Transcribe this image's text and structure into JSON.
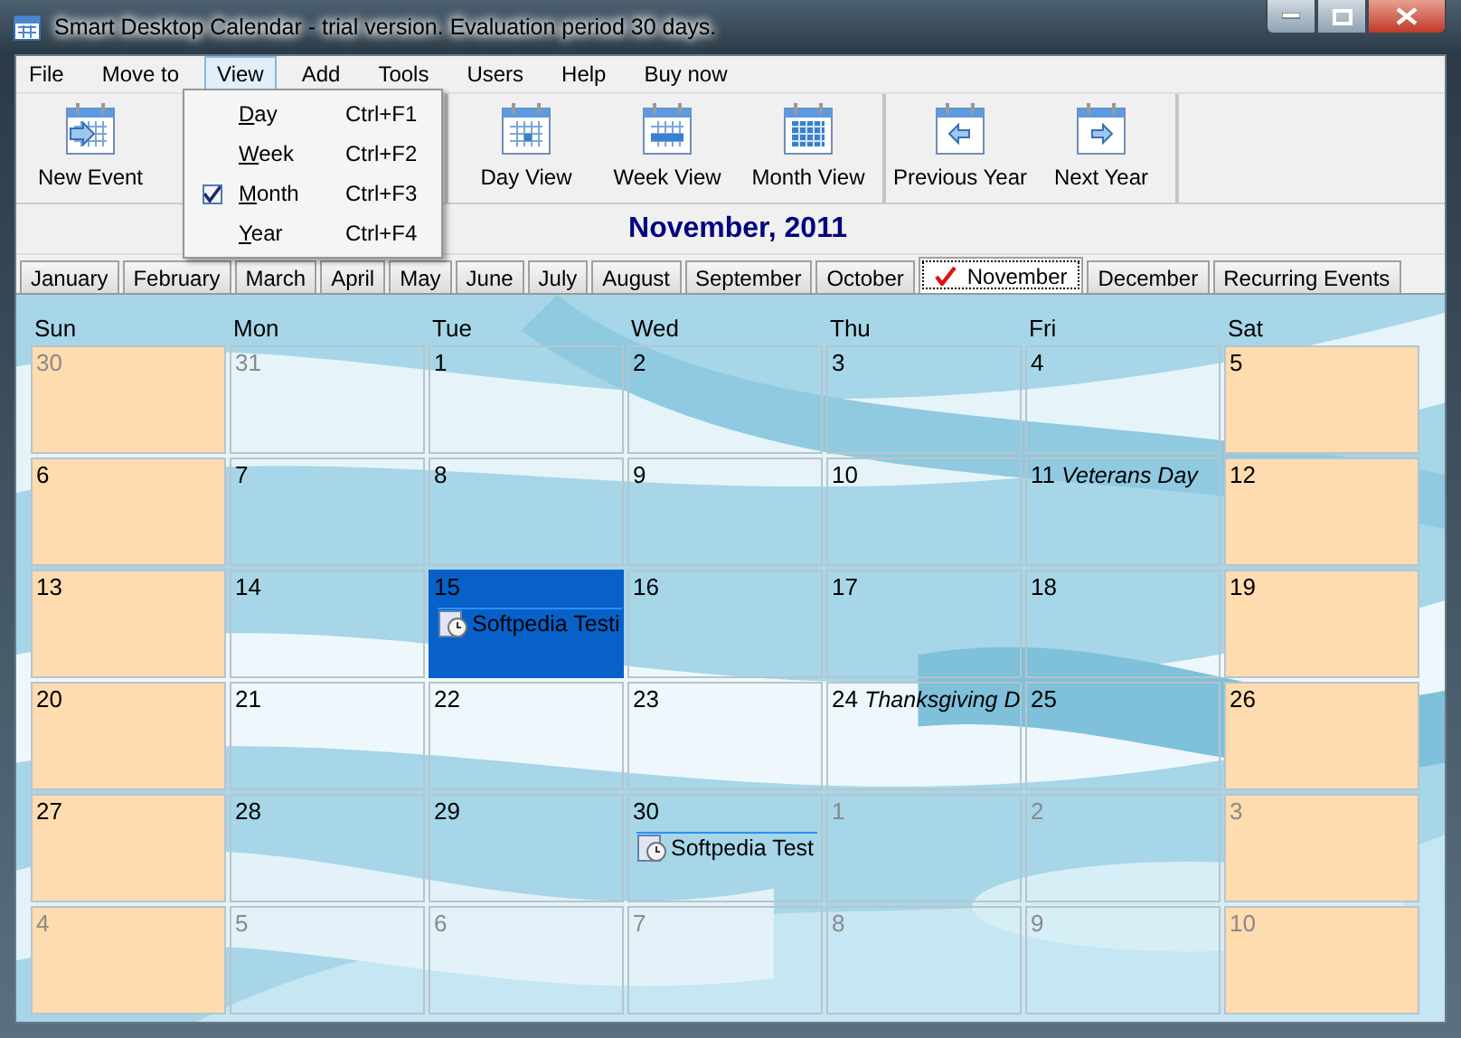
{
  "window": {
    "title": "Smart Desktop Calendar - trial version. Evaluation period 30 days."
  },
  "menu_bar": [
    {
      "label": "File",
      "open": false
    },
    {
      "label": "Move to",
      "open": false
    },
    {
      "label": "View",
      "open": true
    },
    {
      "label": "Add",
      "open": false
    },
    {
      "label": "Tools",
      "open": false
    },
    {
      "label": "Users",
      "open": false
    },
    {
      "label": "Help",
      "open": false
    },
    {
      "label": "Buy now",
      "open": false
    }
  ],
  "view_menu": [
    {
      "label": "Day",
      "shortcut": "Ctrl+F1",
      "checked": false
    },
    {
      "label": "Week",
      "shortcut": "Ctrl+F2",
      "checked": false
    },
    {
      "label": "Month",
      "shortcut": "Ctrl+F3",
      "checked": true
    },
    {
      "label": "Year",
      "shortcut": "Ctrl+F4",
      "checked": false
    }
  ],
  "toolbar": [
    {
      "label": "New Event",
      "kind": "new"
    },
    {
      "label": "Day View",
      "kind": "day"
    },
    {
      "label": "Week View",
      "kind": "week"
    },
    {
      "label": "Month View",
      "kind": "month"
    },
    {
      "label": "Previous Year",
      "kind": "prev"
    },
    {
      "label": "Next Year",
      "kind": "next"
    }
  ],
  "heading": "November, 2011",
  "month_tabs": [
    {
      "label": "January",
      "selected": false
    },
    {
      "label": "February",
      "selected": false
    },
    {
      "label": "March",
      "selected": false
    },
    {
      "label": "April",
      "selected": false
    },
    {
      "label": "May",
      "selected": false
    },
    {
      "label": "June",
      "selected": false
    },
    {
      "label": "July",
      "selected": false
    },
    {
      "label": "August",
      "selected": false
    },
    {
      "label": "September",
      "selected": false
    },
    {
      "label": "October",
      "selected": false
    },
    {
      "label": "November",
      "selected": true
    },
    {
      "label": "December",
      "selected": false
    },
    {
      "label": "Recurring Events",
      "selected": false
    }
  ],
  "calendar": {
    "weekdays": [
      "Sun",
      "Mon",
      "Tue",
      "Wed",
      "Thu",
      "Fri",
      "Sat"
    ],
    "weeks": [
      [
        {
          "day": "30",
          "other_month": true,
          "weekend": true,
          "selected": false
        },
        {
          "day": "31",
          "other_month": true,
          "weekend": false,
          "selected": false
        },
        {
          "day": "1",
          "other_month": false,
          "weekend": false,
          "selected": false
        },
        {
          "day": "2",
          "other_month": false,
          "weekend": false,
          "selected": false
        },
        {
          "day": "3",
          "other_month": false,
          "weekend": false,
          "selected": false
        },
        {
          "day": "4",
          "other_month": false,
          "weekend": false,
          "selected": false
        },
        {
          "day": "5",
          "other_month": false,
          "weekend": true,
          "selected": false
        }
      ],
      [
        {
          "day": "6",
          "other_month": false,
          "weekend": true,
          "selected": false
        },
        {
          "day": "7",
          "other_month": false,
          "weekend": false,
          "selected": false
        },
        {
          "day": "8",
          "other_month": false,
          "weekend": false,
          "selected": false
        },
        {
          "day": "9",
          "other_month": false,
          "weekend": false,
          "selected": false
        },
        {
          "day": "10",
          "other_month": false,
          "weekend": false,
          "selected": false
        },
        {
          "day": "11",
          "other_month": false,
          "weekend": false,
          "selected": false,
          "holiday": "Veterans Day"
        },
        {
          "day": "12",
          "other_month": false,
          "weekend": true,
          "selected": false
        }
      ],
      [
        {
          "day": "13",
          "other_month": false,
          "weekend": true,
          "selected": false
        },
        {
          "day": "14",
          "other_month": false,
          "weekend": false,
          "selected": false
        },
        {
          "day": "15",
          "other_month": false,
          "weekend": false,
          "selected": true,
          "events": [
            "Softpedia Testi"
          ]
        },
        {
          "day": "16",
          "other_month": false,
          "weekend": false,
          "selected": false
        },
        {
          "day": "17",
          "other_month": false,
          "weekend": false,
          "selected": false
        },
        {
          "day": "18",
          "other_month": false,
          "weekend": false,
          "selected": false
        },
        {
          "day": "19",
          "other_month": false,
          "weekend": true,
          "selected": false
        }
      ],
      [
        {
          "day": "20",
          "other_month": false,
          "weekend": true,
          "selected": false
        },
        {
          "day": "21",
          "other_month": false,
          "weekend": false,
          "selected": false
        },
        {
          "day": "22",
          "other_month": false,
          "weekend": false,
          "selected": false
        },
        {
          "day": "23",
          "other_month": false,
          "weekend": false,
          "selected": false
        },
        {
          "day": "24",
          "other_month": false,
          "weekend": false,
          "selected": false,
          "holiday": "Thanksgiving D"
        },
        {
          "day": "25",
          "other_month": false,
          "weekend": false,
          "selected": false
        },
        {
          "day": "26",
          "other_month": false,
          "weekend": true,
          "selected": false
        }
      ],
      [
        {
          "day": "27",
          "other_month": false,
          "weekend": true,
          "selected": false
        },
        {
          "day": "28",
          "other_month": false,
          "weekend": false,
          "selected": false
        },
        {
          "day": "29",
          "other_month": false,
          "weekend": false,
          "selected": false
        },
        {
          "day": "30",
          "other_month": false,
          "weekend": false,
          "selected": false,
          "events": [
            "Softpedia Test"
          ]
        },
        {
          "day": "1",
          "other_month": true,
          "weekend": false,
          "selected": false
        },
        {
          "day": "2",
          "other_month": true,
          "weekend": false,
          "selected": false
        },
        {
          "day": "3",
          "other_month": true,
          "weekend": true,
          "selected": false
        }
      ],
      [
        {
          "day": "4",
          "other_month": true,
          "weekend": true,
          "selected": false
        },
        {
          "day": "5",
          "other_month": true,
          "weekend": false,
          "selected": false
        },
        {
          "day": "6",
          "other_month": true,
          "weekend": false,
          "selected": false
        },
        {
          "day": "7",
          "other_month": true,
          "weekend": false,
          "selected": false
        },
        {
          "day": "8",
          "other_month": true,
          "weekend": false,
          "selected": false
        },
        {
          "day": "9",
          "other_month": true,
          "weekend": false,
          "selected": false
        },
        {
          "day": "10",
          "other_month": true,
          "weekend": true,
          "selected": false
        }
      ]
    ]
  }
}
